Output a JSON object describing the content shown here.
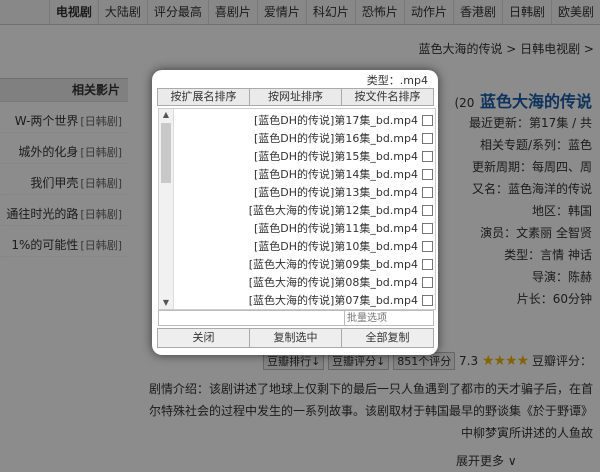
{
  "nav": [
    "欧美剧",
    "日韩剧",
    "香港剧",
    "动作片",
    "恐怖片",
    "科幻片",
    "爱情片",
    "喜剧片",
    "评分最高",
    "大陆剧",
    "电视剧"
  ],
  "breadcrumb": "蓝色大海的传说 > 日韩电视剧 > ",
  "sidebar": {
    "heading": "相关影片",
    "items": [
      {
        "tag": "[日韩剧]",
        "text": "W-两个世界"
      },
      {
        "tag": "[日韩剧]",
        "text": "城外的化身"
      },
      {
        "tag": "[日韩剧]",
        "text": "我们甲壳"
      },
      {
        "tag": "[日韩剧]",
        "text": "通往时光的路"
      },
      {
        "tag": "[日韩剧]",
        "text": "1%的可能性"
      }
    ]
  },
  "main": {
    "title": "蓝色大海的传说",
    "title_year": "(20",
    "lines": [
      "最近更新：第17集 / 共",
      "相关专题/系列：蓝色",
      "更新周期：每周四、周",
      "又名：蓝色海洋的传说",
      "地区：韩国",
      "演员：文素丽 全智贤",
      "类型：言情 神话",
      "导演：陈赫",
      "片长：60分钟"
    ]
  },
  "rating": {
    "label": "豆瓣评分：",
    "stars": "★★★★",
    "score": "7.3",
    "count": "851个评分",
    "btn1": "豆瓣评分↓",
    "btn2": "豆瓣排行↓"
  },
  "description": "剧情介绍：该剧讲述了地球上仅剩下的最后一只人鱼遇到了都市的天才骗子后，在首尔特殊社会的过程中发生的一系列故事。该剧取材于韩国最早的野谈集《於于野谭》中柳梦寅所讲述的人鱼故",
  "more_link": "展开更多 ∨",
  "dialog": {
    "type_label": "类型：.mp4",
    "sort_buttons": [
      "按文件名排序",
      "按网址排序",
      "按扩展名排序"
    ],
    "files": [
      "[蓝色DH的传说]第17集_bd.mp4",
      "[蓝色DH的传说]第16集_bd.mp4",
      "[蓝色DH的传说]第15集_bd.mp4",
      "[蓝色DH的传说]第14集_bd.mp4",
      "[蓝色DH的传说]第13集_bd.mp4",
      "[蓝色大海的传说]第12集_bd.mp4",
      "[蓝色DH的传说]第11集_bd.mp4",
      "[蓝色DH的传说]第10集_bd.mp4",
      "[蓝色大海的传说]第09集_bd.mp4",
      "[蓝色大海的传说]第08集_bd.mp4",
      "[蓝色大海的传说]第07集_bd.mp4"
    ],
    "filter_placeholder": "批量选项",
    "buttons": [
      "全部复制",
      "复制选中",
      "关闭"
    ]
  }
}
